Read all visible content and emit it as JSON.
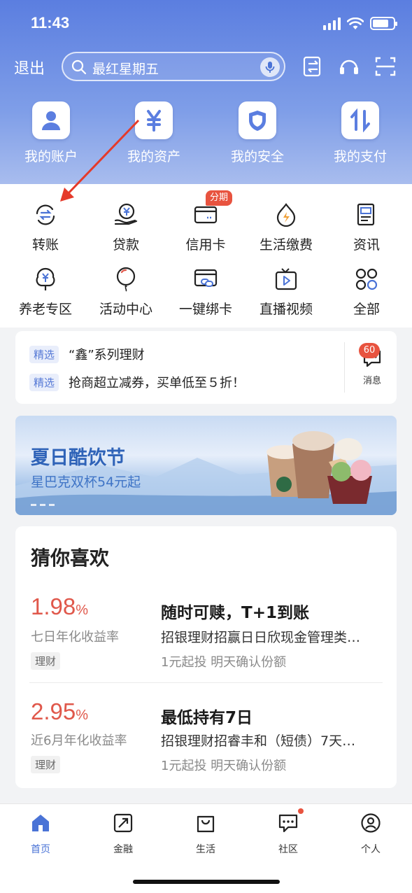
{
  "status_bar": {
    "time": "11:43"
  },
  "header": {
    "logout": "退出",
    "search_text": "最红星期五",
    "colors": {
      "gradient_top": "#5b7ee0",
      "gradient_bottom": "#a9bdee"
    }
  },
  "top_shortcuts": [
    {
      "label": "我的账户",
      "icon": "user-icon"
    },
    {
      "label": "我的资产",
      "icon": "yuan-icon"
    },
    {
      "label": "我的安全",
      "icon": "shield-icon"
    },
    {
      "label": "我的支付",
      "icon": "transfer-arrows-icon"
    }
  ],
  "grid": [
    {
      "label": "转账",
      "icon": "transfer-icon"
    },
    {
      "label": "贷款",
      "icon": "loan-icon"
    },
    {
      "label": "信用卡",
      "icon": "credit-card-icon",
      "badge": "分期"
    },
    {
      "label": "生活缴费",
      "icon": "flame-icon"
    },
    {
      "label": "资讯",
      "icon": "news-icon"
    },
    {
      "label": "养老专区",
      "icon": "pension-icon"
    },
    {
      "label": "活动中心",
      "icon": "balloon-icon"
    },
    {
      "label": "一键绑卡",
      "icon": "bind-card-icon"
    },
    {
      "label": "直播视频",
      "icon": "live-tv-icon"
    },
    {
      "label": "全部",
      "icon": "all-apps-icon"
    }
  ],
  "news": {
    "items": [
      {
        "tag": "精选",
        "text": "“鑫”系列理财"
      },
      {
        "tag": "精选",
        "text": "抢商超立减券，买单低至５折！"
      }
    ],
    "message_label": "消息",
    "message_badge": "60"
  },
  "banner": {
    "title": "夏日酷饮节",
    "subtitle": "星巴克双杯54元起"
  },
  "recommend": {
    "title": "猜你喜欢",
    "products": [
      {
        "rate": "1.98",
        "rate_unit": "%",
        "rate_label": "七日年化收益率",
        "tag": "理财",
        "name": "随时可赎，T+1到账",
        "desc": "招银理财招赢日日欣现金管理类…",
        "condition": "1元起投 明天确认份额"
      },
      {
        "rate": "2.95",
        "rate_unit": "%",
        "rate_label": "近6月年化收益率",
        "tag": "理财",
        "name": "最低持有7日",
        "desc": "招银理财招睿丰和（短债）7天…",
        "condition": "1元起投 明天确认份额"
      }
    ]
  },
  "bottom_nav": [
    {
      "label": "首页",
      "icon": "home-icon",
      "active": true
    },
    {
      "label": "金融",
      "icon": "finance-icon"
    },
    {
      "label": "生活",
      "icon": "shopping-bag-icon"
    },
    {
      "label": "社区",
      "icon": "chat-icon"
    },
    {
      "label": "个人",
      "icon": "profile-icon"
    }
  ]
}
